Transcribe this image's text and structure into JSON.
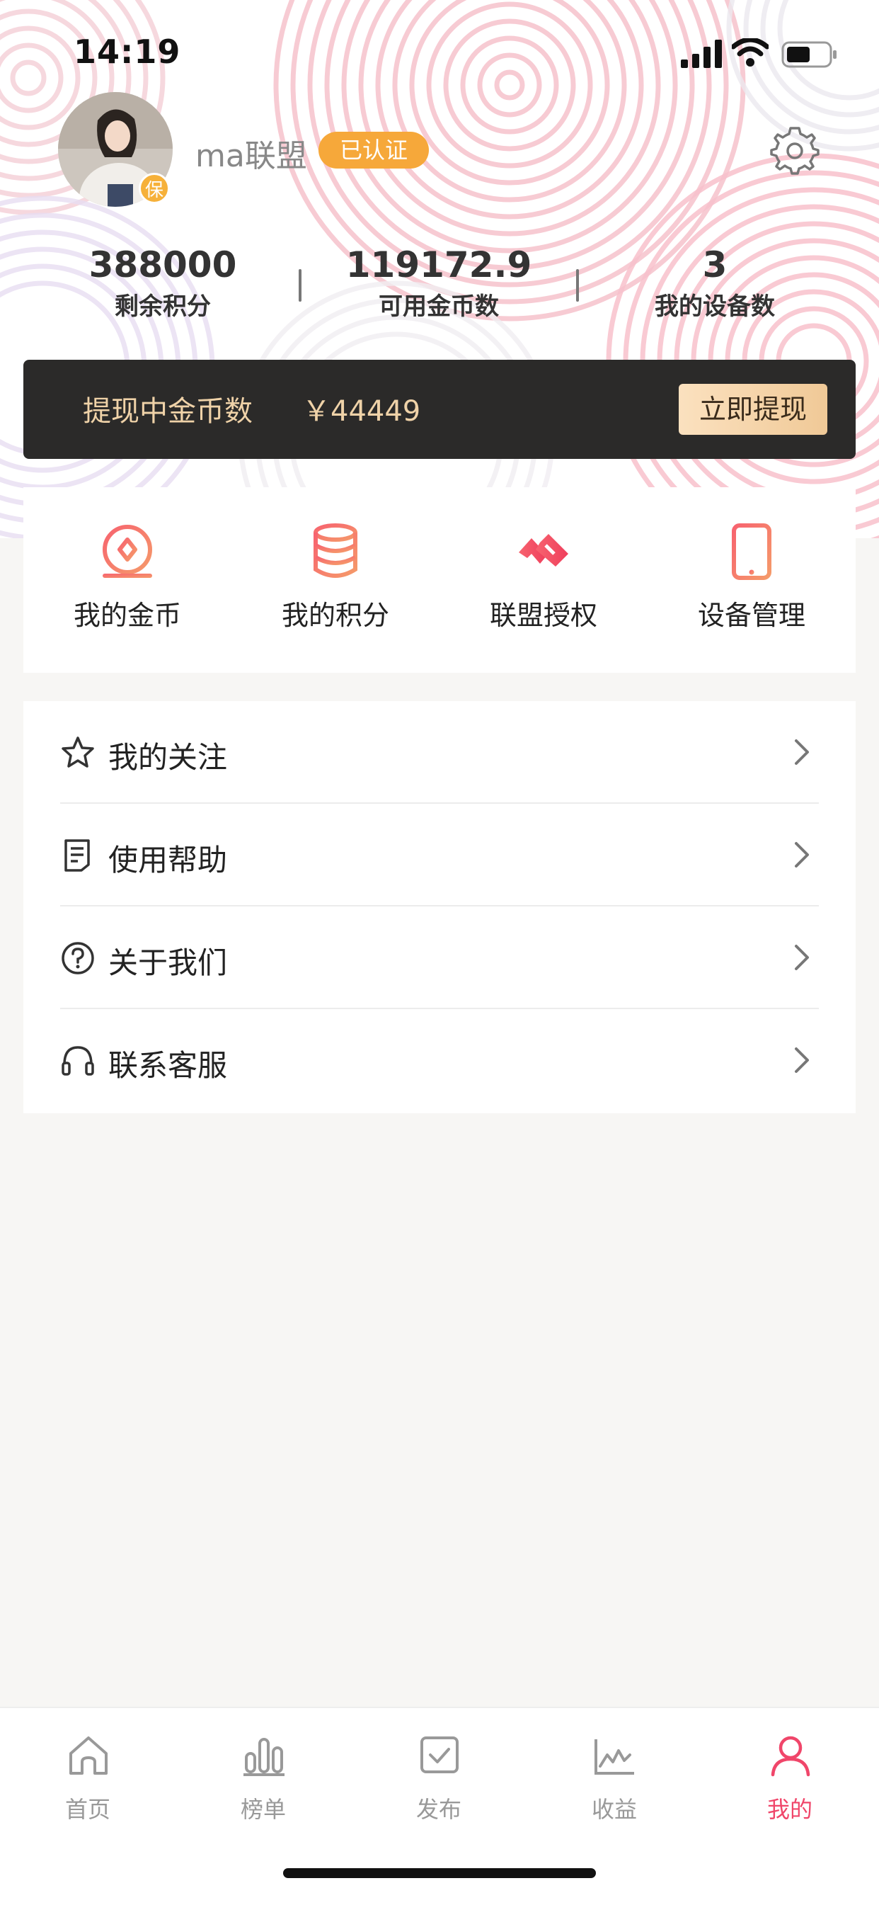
{
  "status_bar": {
    "time": "14:19"
  },
  "profile": {
    "username": "ma联盟",
    "verified_label": "已认证",
    "avatar_badge": "保"
  },
  "stats": [
    {
      "value": "388000",
      "label": "剩余积分"
    },
    {
      "value": "119172.9",
      "label": "可用金币数"
    },
    {
      "value": "3",
      "label": "我的设备数"
    }
  ],
  "withdraw": {
    "label": "提现中金币数",
    "amount": "￥44449",
    "button": "立即提现"
  },
  "quick_actions": [
    {
      "label": "我的金币",
      "icon": "coin-icon"
    },
    {
      "label": "我的积分",
      "icon": "points-stack-icon"
    },
    {
      "label": "联盟授权",
      "icon": "alliance-icon"
    },
    {
      "label": "设备管理",
      "icon": "phone-icon"
    }
  ],
  "menu": [
    {
      "label": "我的关注",
      "icon": "star-icon"
    },
    {
      "label": "使用帮助",
      "icon": "document-icon"
    },
    {
      "label": "关于我们",
      "icon": "question-icon"
    },
    {
      "label": "联系客服",
      "icon": "headset-icon"
    }
  ],
  "tabs": [
    {
      "label": "首页",
      "icon": "home-icon",
      "active": false
    },
    {
      "label": "榜单",
      "icon": "ranking-icon",
      "active": false
    },
    {
      "label": "发布",
      "icon": "publish-icon",
      "active": false
    },
    {
      "label": "收益",
      "icon": "earnings-icon",
      "active": false
    },
    {
      "label": "我的",
      "icon": "profile-icon",
      "active": true
    }
  ],
  "colors": {
    "accent": "#f0466a",
    "verified_badge": "#f6a83a",
    "withdraw_bg": "#2b2a29",
    "withdraw_text": "#efd2a8",
    "page_bg": "#f7f6f4"
  }
}
